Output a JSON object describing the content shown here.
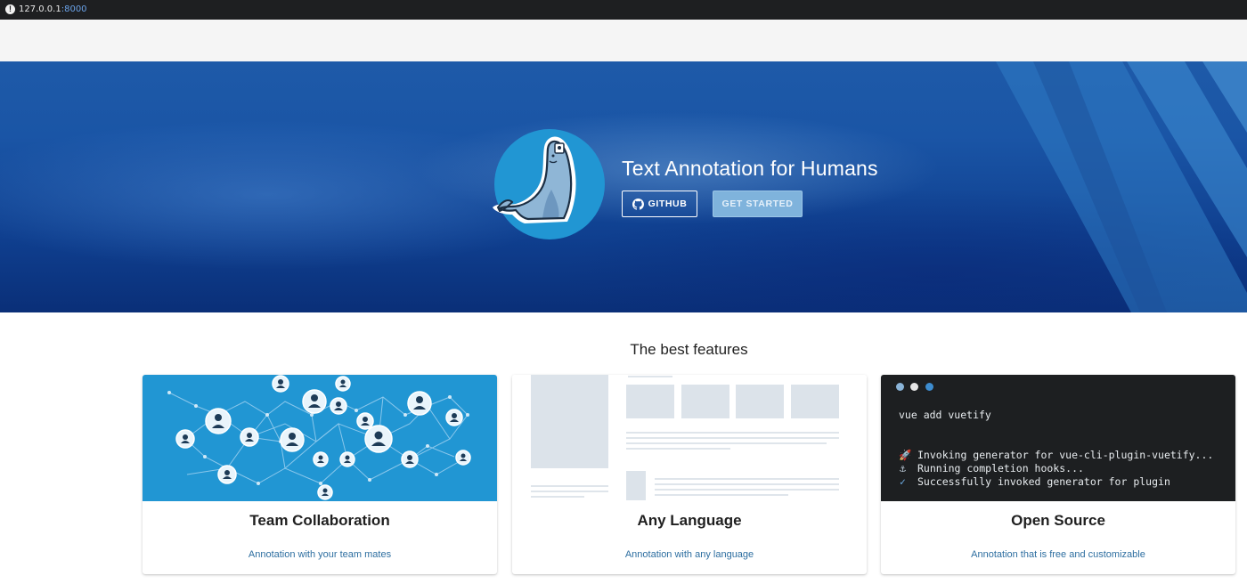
{
  "browser": {
    "url_host": "127.0.0.1",
    "url_port": ":8000"
  },
  "hero": {
    "title": "Text Annotation for Humans",
    "github_label": "GITHUB",
    "get_started_label": "GET STARTED",
    "logo_icon": "seal-logo-icon"
  },
  "features": {
    "heading": "The best features",
    "cards": [
      {
        "title": "Team Collaboration",
        "subtitle": "Annotation with your team mates",
        "media_icon": "network-people-icon"
      },
      {
        "title": "Any Language",
        "subtitle": "Annotation with any language",
        "media_icon": "layout-placeholder-icon"
      },
      {
        "title": "Open Source",
        "subtitle": "Annotation that is free and customizable",
        "terminal": {
          "command": "vue add vuetify",
          "lines": [
            "Invoking generator for vue-cli-plugin-vuetify...",
            "Running completion hooks...",
            "Successfully invoked generator for plugin"
          ]
        }
      }
    ]
  },
  "colors": {
    "hero_blue": "#1a55a6",
    "accent_button": "#7fb3dc",
    "link_blue": "#2d6ea0",
    "network_bg": "#2196d3"
  }
}
